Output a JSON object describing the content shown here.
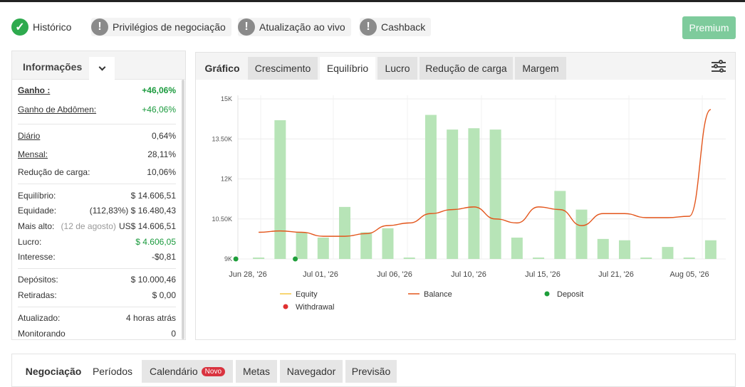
{
  "status_bar": [
    {
      "label": "Histórico",
      "icon": "check-circle-icon",
      "state": "ok"
    },
    {
      "label": "Privilégios de negociação",
      "icon": "exclamation-circle-icon",
      "state": "warn"
    },
    {
      "label": "Atualização ao vivo",
      "icon": "exclamation-circle-icon",
      "state": "warn"
    },
    {
      "label": "Cashback",
      "icon": "exclamation-circle-icon",
      "state": "warn"
    }
  ],
  "premium_label": "Premium",
  "info": {
    "title": "Informações",
    "rows": [
      {
        "label": "Ganho :",
        "value": "+46,06%"
      },
      {
        "label": "Ganho de Abdômen:",
        "value": "+46,06%"
      },
      {
        "label": "Diário",
        "value": "0,64%"
      },
      {
        "label": "Mensal:",
        "value": "28,11%"
      },
      {
        "label": "Redução de carga:",
        "value": "10,06%"
      },
      {
        "label": "Equilíbrio:",
        "value": "$ 14.606,51"
      },
      {
        "label": "Equidade:",
        "note": "(112,83%)",
        "value": "$ 16.480,43"
      },
      {
        "label": "Mais alto:",
        "note": "(12 de agosto)",
        "value": "US$ 14.606,51"
      },
      {
        "label": "Lucro:",
        "value": "$ 4.606,05"
      },
      {
        "label": "Interesse:",
        "value": "-$0,81"
      },
      {
        "label": "Depósitos:",
        "value": "$ 10.000,46"
      },
      {
        "label": "Retiradas:",
        "value": "$ 0,00"
      },
      {
        "label": "Atualizado:",
        "value": "4 horas atrás"
      },
      {
        "label": "Monitorando",
        "value": "0"
      }
    ]
  },
  "chart_tabs": {
    "label": "Gráfico",
    "tabs": [
      "Crescimento",
      "Equilíbrio",
      "Lucro",
      "Redução de carga",
      "Margem"
    ],
    "active": "Equilíbrio"
  },
  "chart_data": {
    "type": "bar",
    "y_ticks": [
      "15K",
      "13.50K",
      "12K",
      "10.50K",
      "9K"
    ],
    "ylim": [
      9000,
      15000
    ],
    "x_ticks": [
      "Jun 28, '26",
      "Jul 01, '26",
      "Jul 06, '26",
      "Jul 10, '26",
      "Jul 15, '26",
      "Jul 21, '26",
      "Aug 05, '26"
    ],
    "bar_values": [
      9000,
      14200,
      10000,
      9800,
      10950,
      10000,
      10150,
      9050,
      14400,
      13850,
      13900,
      13850,
      9800,
      9000,
      11550,
      10850,
      9750,
      9700,
      9050,
      9450,
      9050,
      9700
    ],
    "balance_line": [
      10000,
      10050,
      10000,
      9850,
      9850,
      9950,
      10250,
      10350,
      10700,
      10850,
      10950,
      10500,
      10350,
      10950,
      10850,
      10250,
      10700,
      10700,
      10550,
      10550,
      10600,
      14600
    ],
    "deposits": [
      9000,
      9000
    ],
    "legend": [
      {
        "name": "Equity",
        "color": "#f5c842",
        "kind": "line"
      },
      {
        "name": "Balance",
        "color": "#e3551b",
        "kind": "line"
      },
      {
        "name": "Deposit",
        "color": "#1e9e3a",
        "kind": "dot"
      },
      {
        "name": "Withdrawal",
        "color": "#e03030",
        "kind": "dot"
      }
    ],
    "bar_color": "#b7e4b7",
    "balance_color": "#e3551b"
  },
  "bottom_tabs": {
    "label": "Negociação",
    "tabs": [
      "Períodos",
      "Calendário",
      "Metas",
      "Navegador",
      "Previsão"
    ],
    "active": "Períodos",
    "badge": "Novo"
  }
}
